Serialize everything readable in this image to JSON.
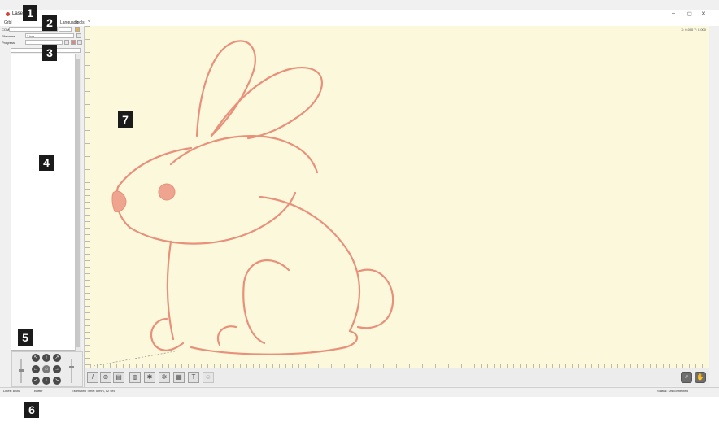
{
  "window": {
    "title": "Lase",
    "min_icon": "–",
    "max_icon": "◻",
    "close_icon": "✕"
  },
  "menu": {
    "items": [
      "Grbl",
      "Language",
      "Tools",
      "?"
    ]
  },
  "left": {
    "com_label": "COM",
    "filename_label": "Filename",
    "filename_value": "2.jpg",
    "progress_label": "Progress"
  },
  "canvas": {
    "coordinates": "X: 0.000 Y: 0.000"
  },
  "status": {
    "lines": "Lines: 8286",
    "buffer": "Buffer",
    "estimated_time": "Estimated Time:  5 min, 52 sec",
    "status_text": "Status:  Disconnected"
  },
  "badges": [
    "1",
    "2",
    "3",
    "4",
    "5",
    "6",
    "7"
  ],
  "colors": {
    "canvas_bg": "#fcf8dc",
    "outline": "#e8907a",
    "badge_bg": "#1b1b1b"
  }
}
